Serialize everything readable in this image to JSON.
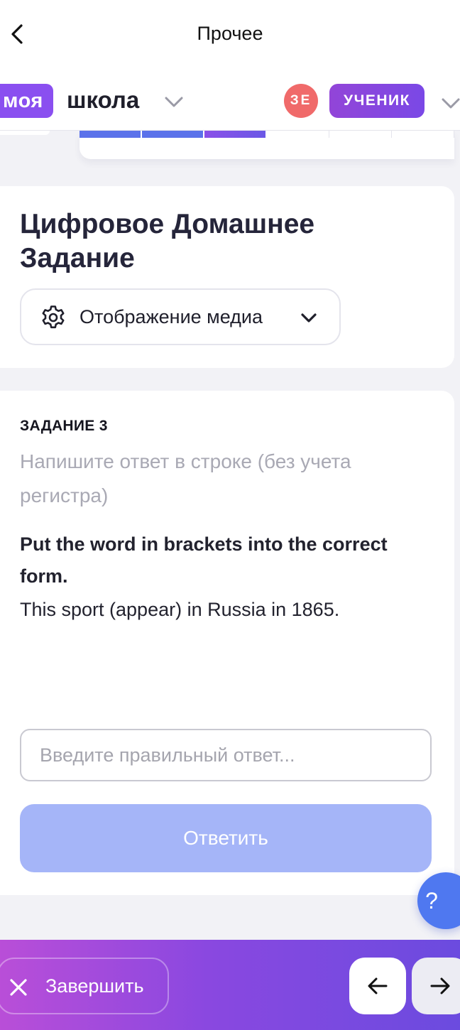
{
  "topbar": {
    "title": "Прочее",
    "back_icon": "chevron-left-icon"
  },
  "school_header": {
    "logo_badge": "моя",
    "logo_text": "школа",
    "avatar_initials": "ЗЕ",
    "role_label": "УЧЕНИК",
    "colors": {
      "brand": "#8a4ff0",
      "avatar": "#f06a6a"
    }
  },
  "progress": {
    "segments": [
      "done",
      "done",
      "current",
      "todo",
      "todo",
      "todo"
    ]
  },
  "homework": {
    "title": "Цифровое Домашнее Задание",
    "media_dropdown_label": "Отображение медиа",
    "media_icon": "gear-icon"
  },
  "task": {
    "number_label": "ЗАДАНИЕ 3",
    "hint": "Напишите ответ в строке (без учета регистра)",
    "instruction": "Put the word in brackets into the correct form.",
    "sentence": "This sport (appear) in Russia in 1865.",
    "answer_placeholder": "Введите правильный ответ...",
    "answer_value": "",
    "submit_label": "Ответить"
  },
  "help": {
    "label": "?"
  },
  "bottom_bar": {
    "finish_label": "Завершить",
    "prev_icon": "arrow-left-icon",
    "next_icon": "arrow-right-icon",
    "accent_gradient": [
      "#b94ed8",
      "#6b4bdf"
    ]
  }
}
